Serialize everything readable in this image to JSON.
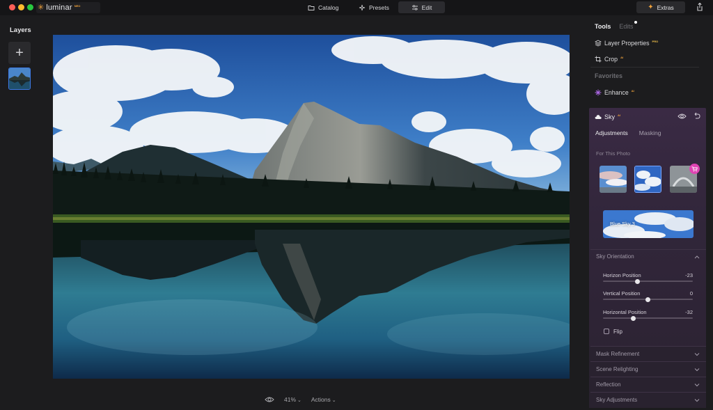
{
  "app": {
    "name": "luminar",
    "badge": "NEO"
  },
  "nav": {
    "catalog": "Catalog",
    "presets": "Presets",
    "edit": "Edit"
  },
  "header": {
    "extras": "Extras"
  },
  "layers": {
    "title": "Layers"
  },
  "canvas": {
    "zoom": "41%",
    "actions": "Actions"
  },
  "panel": {
    "tabs": {
      "tools": "Tools",
      "edits": "Edits"
    },
    "tools": {
      "layer_properties": "Layer Properties",
      "layer_properties_badge": "PRO",
      "crop": "Crop",
      "crop_badge": "AI"
    },
    "favorites": {
      "title": "Favorites",
      "enhance": "Enhance",
      "enhance_badge": "AI"
    },
    "sky": {
      "title": "Sky",
      "badge": "AI",
      "tabs": {
        "adjustments": "Adjustments",
        "masking": "Masking"
      },
      "for_this_photo": "For This Photo",
      "selected_sky": "Blue Sky 3",
      "orientation": {
        "title": "Sky Orientation",
        "horizon": {
          "label": "Horizon Position",
          "value": "-23",
          "level": -23
        },
        "vertical": {
          "label": "Vertical Position",
          "value": "0",
          "level": 0
        },
        "horizontal": {
          "label": "Horizontal Position",
          "value": "-32",
          "level": -32
        },
        "flip": "Flip"
      },
      "sections": {
        "mask_refinement": "Mask Refinement",
        "scene_relighting": "Scene Relighting",
        "reflection": "Reflection",
        "sky_adjustments": "Sky Adjustments"
      }
    }
  },
  "colors": {
    "accent_blue": "#3d7ae6",
    "accent_orange": "#f2a33c",
    "cart_pink": "#e043b3"
  }
}
